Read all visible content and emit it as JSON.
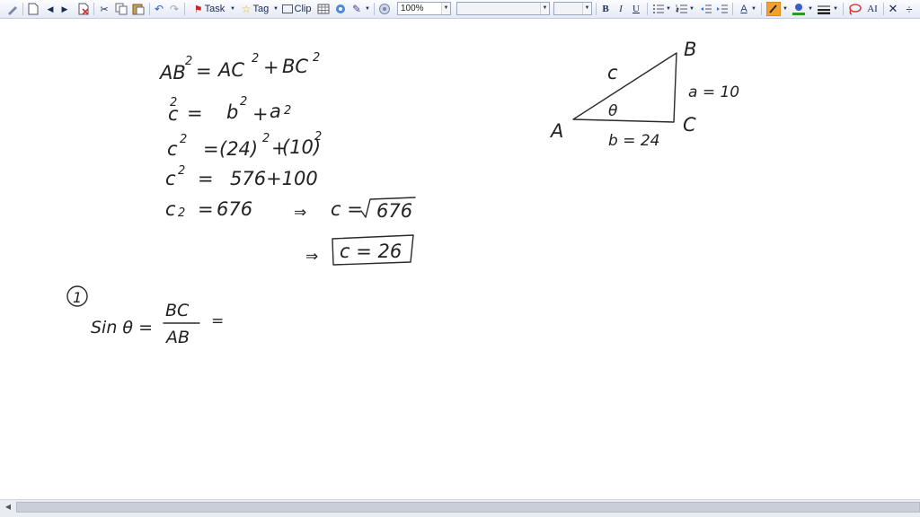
{
  "toolbar": {
    "task_label": "Task",
    "tag_label": "Tag",
    "clip_label": "Clip",
    "zoom_value": "100%",
    "font_value": "",
    "size_value": "",
    "bold": "B",
    "italic": "I",
    "underline": "U",
    "font_color_glyph": "A",
    "ab_glyph": "AI"
  },
  "accent_colors": {
    "highlighter": "#f2a12b",
    "fill": "#2a9a2a",
    "pen_stroke": "#d63a3a"
  },
  "notes": {
    "eq1": {
      "lhs": "AB",
      "lhs_exp": "2",
      "eq": "=",
      "t1": "AC",
      "t1_exp": "2",
      "plus": "+",
      "t2": "BC",
      "t2_exp": "2"
    },
    "eq2": {
      "lhs": "c",
      "lhs_exp": "2",
      "eq": "=",
      "t1": "b",
      "t1_exp": "2",
      "plus": "+",
      "t2": "a",
      "t2_exp": "2"
    },
    "eq3": {
      "lhs": "c",
      "lhs_exp": "2",
      "eq": "=",
      "t1": "(24)",
      "t1_exp": "2",
      "plus": "+",
      "t2": "(10)",
      "t2_exp": "2"
    },
    "eq4": {
      "lhs": "c",
      "lhs_exp": "2",
      "eq": "=",
      "rhs": "576+100"
    },
    "eq5": {
      "lhs": "c",
      "lhs_exp": "2",
      "eq": "=",
      "rhs": "676",
      "implies": "⇒",
      "c_eq": "c =",
      "radicand": "676"
    },
    "eq6": {
      "implies": "⇒",
      "boxed": "c = 26"
    },
    "triangle": {
      "A": "A",
      "B": "B",
      "C": "C",
      "hyp": "c",
      "side_a": "a = 10",
      "side_b": "b = 24",
      "angle": "θ"
    },
    "part1": {
      "marker": "1",
      "lhs": "Sin θ =",
      "num": "BC",
      "den": "AB",
      "tail": "="
    }
  }
}
